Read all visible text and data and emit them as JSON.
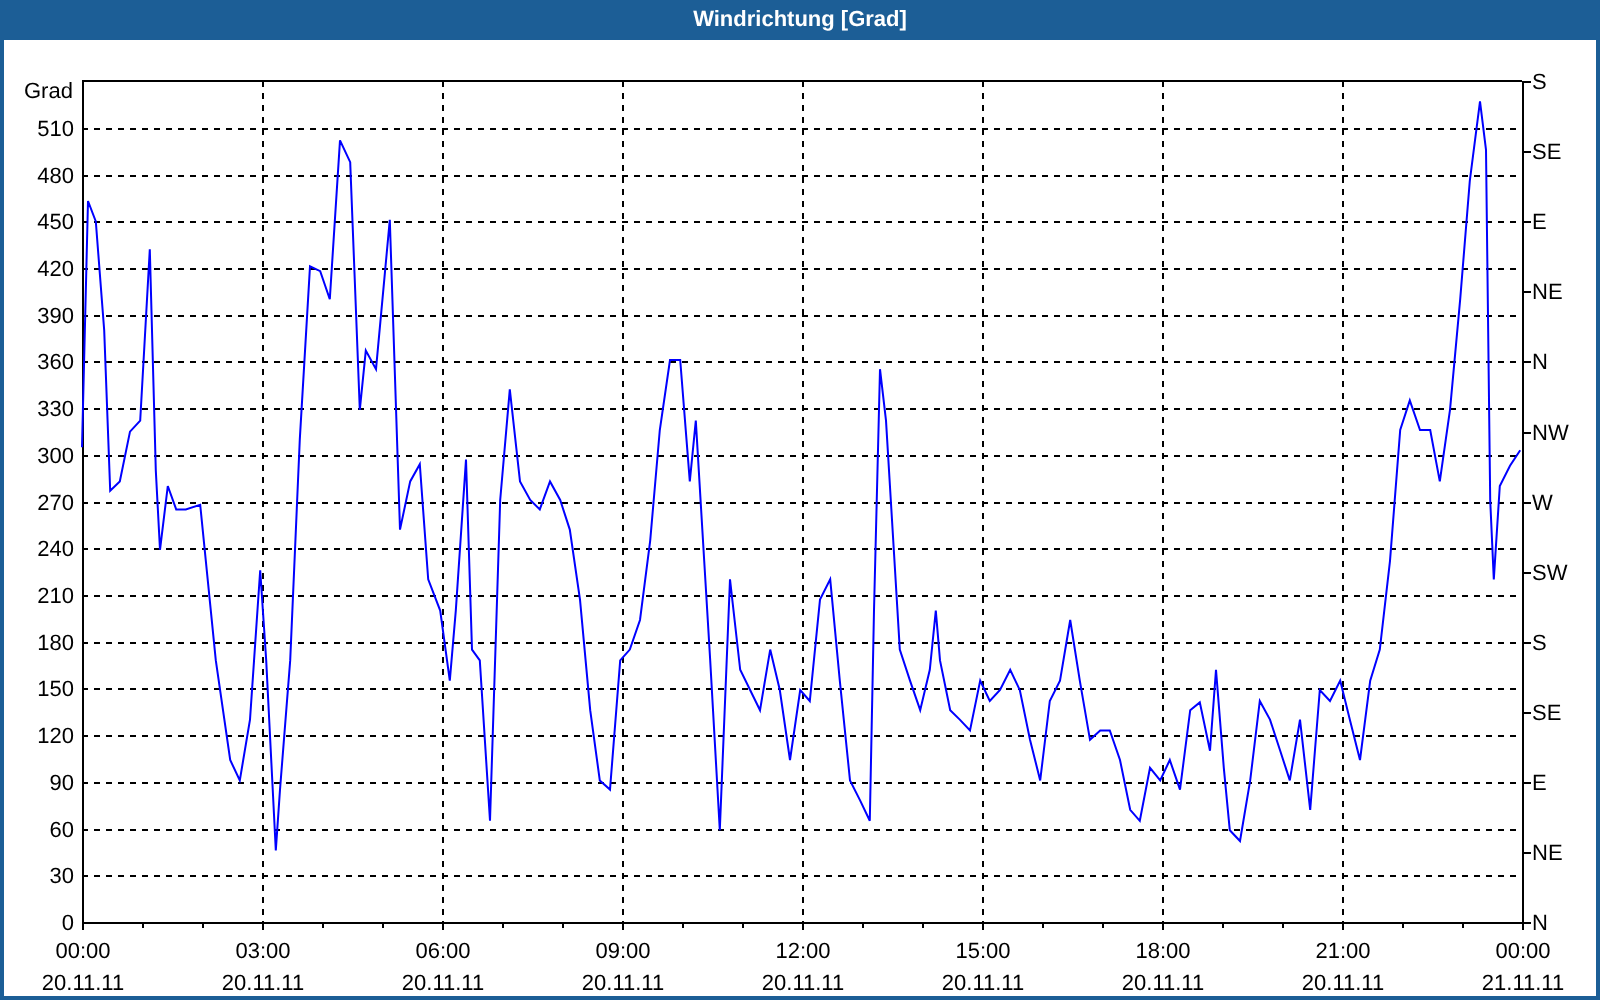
{
  "window": {
    "title": "Windrichtung [Grad]"
  },
  "chart": {
    "direction_labels": [
      "S",
      "SE",
      "E",
      "NE",
      "N",
      "NW",
      "W",
      "SW",
      "S",
      "SE",
      "E",
      "NE",
      "N"
    ],
    "x_dates": [
      "20.11.11",
      "20.11.11",
      "20.11.11",
      "20.11.11",
      "20.11.11",
      "20.11.11",
      "20.11.11",
      "20.11.11",
      "21.11.11"
    ],
    "chart_data": {
      "type": "line",
      "grid": true,
      "ylabel": "Grad",
      "xlim": [
        0,
        24
      ],
      "ylim": [
        0,
        540
      ],
      "xticks": [
        {
          "value": 0,
          "label": "00:00"
        },
        {
          "value": 3,
          "label": "03:00"
        },
        {
          "value": 6,
          "label": "06:00"
        },
        {
          "value": 9,
          "label": "09:00"
        },
        {
          "value": 12,
          "label": "12:00"
        },
        {
          "value": 15,
          "label": "15:00"
        },
        {
          "value": 18,
          "label": "18:00"
        },
        {
          "value": 21,
          "label": "21:00"
        },
        {
          "value": 24,
          "label": "00:00"
        }
      ],
      "yticks": [
        0,
        30,
        60,
        90,
        120,
        150,
        180,
        210,
        240,
        270,
        300,
        330,
        360,
        390,
        420,
        450,
        480,
        510
      ],
      "x": [
        0,
        0.1,
        0.23,
        0.37,
        0.47,
        0.63,
        0.8,
        0.97,
        1.13,
        1.23,
        1.3,
        1.43,
        1.57,
        1.73,
        1.97,
        2.23,
        2.47,
        2.63,
        2.8,
        2.97,
        3.07,
        3.23,
        3.3,
        3.47,
        3.63,
        3.8,
        3.97,
        4.13,
        4.3,
        4.47,
        4.63,
        4.73,
        4.9,
        5.13,
        5.3,
        5.47,
        5.63,
        5.77,
        5.97,
        6.13,
        6.23,
        6.4,
        6.5,
        6.63,
        6.8,
        6.97,
        7.13,
        7.3,
        7.47,
        7.63,
        7.8,
        7.97,
        8.13,
        8.3,
        8.47,
        8.63,
        8.8,
        8.97,
        9.13,
        9.3,
        9.47,
        9.63,
        9.8,
        9.97,
        10.13,
        10.23,
        10.37,
        10.47,
        10.63,
        10.8,
        10.97,
        11.3,
        11.47,
        11.63,
        11.8,
        11.97,
        12.13,
        12.3,
        12.47,
        12.63,
        12.8,
        12.97,
        13.13,
        13.2,
        13.3,
        13.4,
        13.53,
        13.63,
        13.8,
        13.97,
        14.13,
        14.23,
        14.3,
        14.47,
        14.63,
        14.8,
        14.97,
        15.13,
        15.3,
        15.47,
        15.63,
        15.8,
        15.97,
        16.13,
        16.3,
        16.47,
        16.63,
        16.8,
        16.97,
        17.13,
        17.3,
        17.47,
        17.63,
        17.8,
        17.97,
        18.13,
        18.3,
        18.47,
        18.63,
        18.8,
        18.9,
        19.03,
        19.13,
        19.3,
        19.47,
        19.63,
        19.8,
        19.97,
        20.13,
        20.3,
        20.47,
        20.63,
        20.8,
        20.97,
        21.13,
        21.3,
        21.47,
        21.63,
        21.8,
        21.97,
        22.13,
        22.3,
        22.47,
        22.63,
        22.8,
        22.97,
        23.13,
        23.3,
        23.4,
        23.47,
        23.53,
        23.63,
        23.8,
        23.97
      ],
      "series": [
        {
          "color": "#0000ff",
          "values": [
            305,
            463,
            450,
            380,
            277,
            283,
            315,
            322,
            432,
            290,
            239,
            280,
            265,
            265,
            268,
            168,
            104,
            91,
            130,
            226,
            168,
            46,
            85,
            168,
            310,
            421,
            418,
            400,
            502,
            488,
            329,
            367,
            355,
            451,
            252,
            283,
            294,
            220,
            200,
            155,
            200,
            297,
            175,
            168,
            65,
            271,
            342,
            283,
            271,
            265,
            283,
            271,
            252,
            207,
            136,
            91,
            85,
            168,
            175,
            194,
            245,
            316,
            361,
            361,
            283,
            322,
            232,
            168,
            59,
            220,
            162,
            136,
            175,
            149,
            104,
            149,
            142,
            207,
            220,
            155,
            91,
            78,
            65,
            200,
            355,
            322,
            239,
            175,
            155,
            136,
            162,
            200,
            168,
            136,
            130,
            123,
            155,
            142,
            149,
            162,
            149,
            117,
            91,
            142,
            155,
            194,
            155,
            117,
            123,
            123,
            104,
            72,
            65,
            99,
            91,
            104,
            85,
            136,
            141,
            110,
            162,
            99,
            59,
            52,
            91,
            142,
            130,
            110,
            91,
            130,
            72,
            149,
            142,
            155,
            130,
            104,
            155,
            175,
            232,
            316,
            335,
            316,
            316,
            283,
            329,
            400,
            476,
            527,
            496,
            271,
            220,
            280,
            293,
            303
          ]
        }
      ]
    }
  }
}
